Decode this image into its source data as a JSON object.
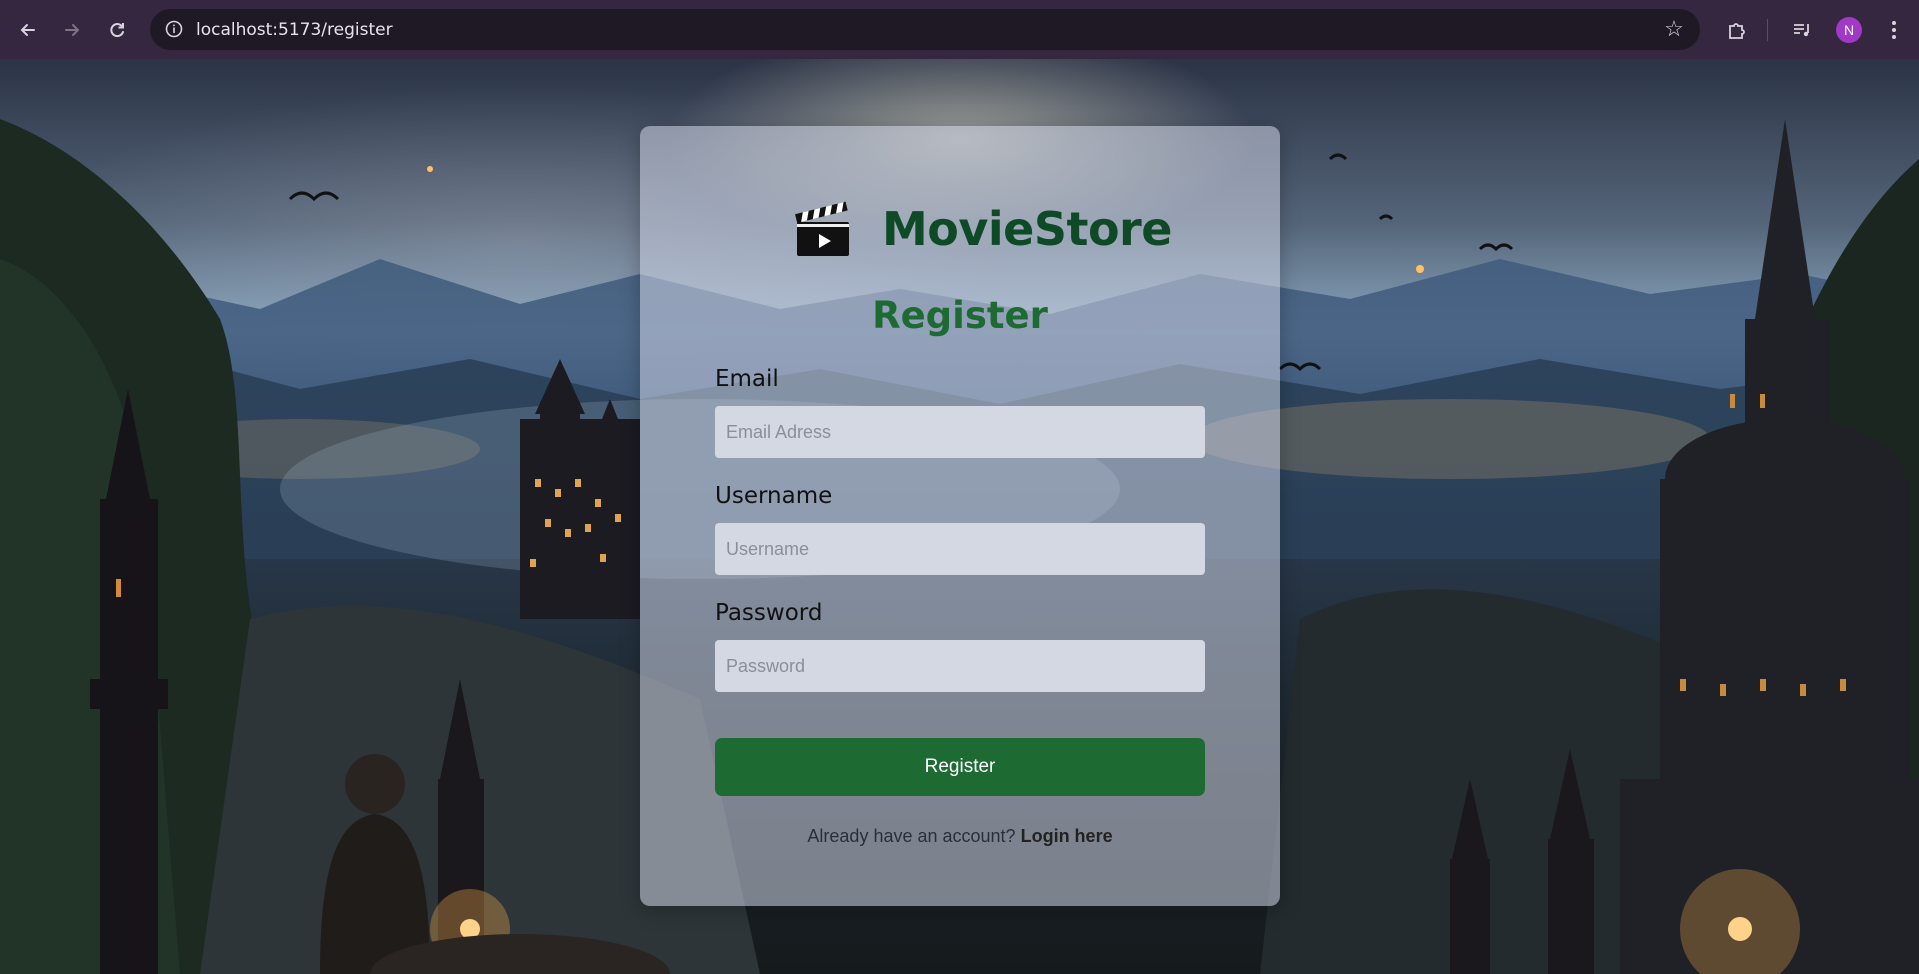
{
  "browser": {
    "url": "localhost:5173/register",
    "avatar_initial": "N"
  },
  "brand": {
    "name": "MovieStore"
  },
  "form": {
    "title": "Register",
    "email": {
      "label": "Email",
      "placeholder": "Email Adress",
      "value": ""
    },
    "username": {
      "label": "Username",
      "placeholder": "Username",
      "value": ""
    },
    "password": {
      "label": "Password",
      "placeholder": "Password",
      "value": ""
    },
    "submit_label": "Register",
    "footer_prompt": "Already have an account?",
    "footer_link": "Login here"
  },
  "colors": {
    "brand_green": "#0f4a26",
    "accent_green": "#1d6b33",
    "avatar_purple": "#a238c6"
  }
}
